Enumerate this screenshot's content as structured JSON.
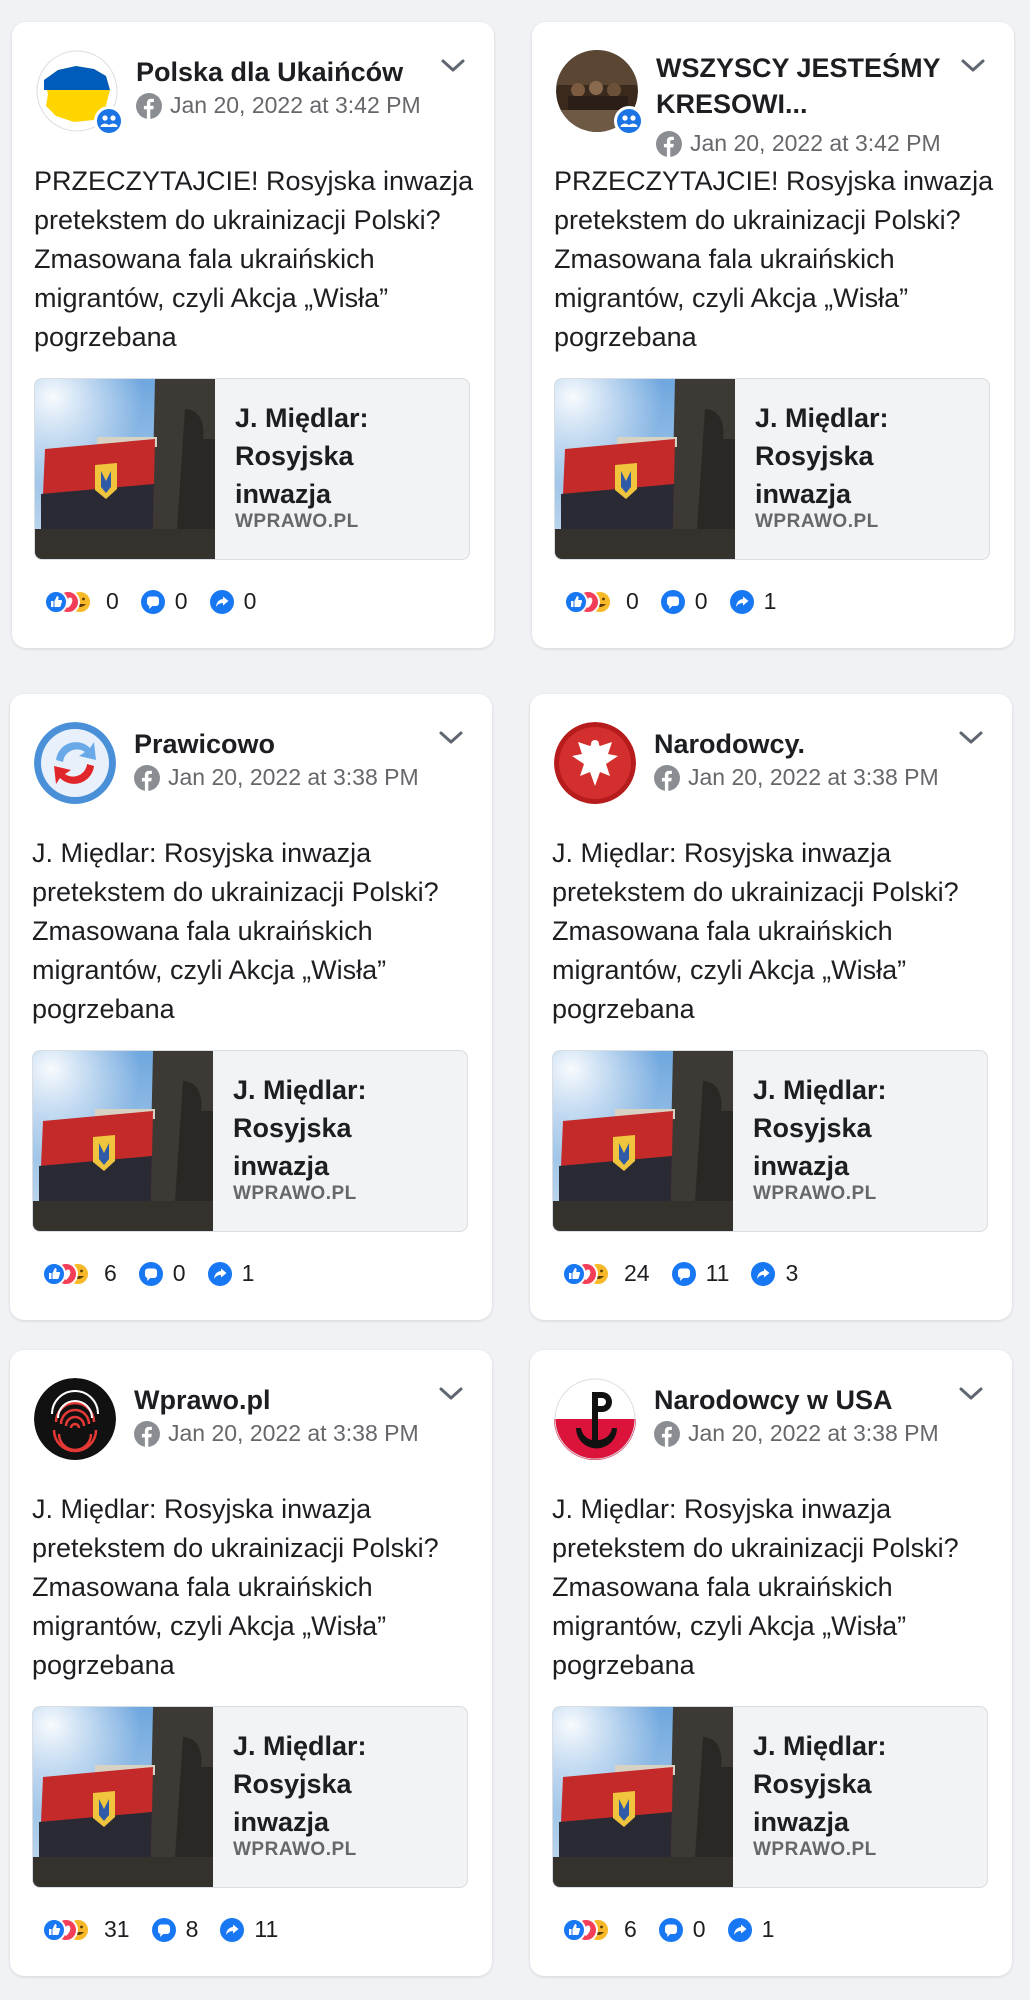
{
  "posts": [
    {
      "page_name": "Polska dla Ukaińców",
      "page_name_lines": 1,
      "timestamp": "Jan 20, 2022 at 3:42 PM",
      "is_group": true,
      "avatar": "poland-map-ukraine-flag",
      "text": "PRZECZYTAJCIE! Rosyjska inwazja pretekstem do ukrainizacji Polski? Zmasowana fala ukraińskich migrantów, czyli Akcja „Wisła” pogrzebana",
      "link_title": "J. Międlar:\nRosyjska\ninwazja",
      "link_domain": "WPRAWO.PL",
      "reactions": "0",
      "comments": "0",
      "shares": "0"
    },
    {
      "page_name": "WSZYSCY JESTEŚMY\nKRESOWI...",
      "page_name_lines": 2,
      "timestamp": "Jan 20, 2022 at 3:42 PM",
      "is_group": true,
      "avatar": "group-photo",
      "text": "PRZECZYTAJCIE! Rosyjska inwazja pretekstem do ukrainizacji Polski? Zmasowana fala ukraińskich migrantów, czyli Akcja „Wisła” pogrzebana",
      "link_title": "J. Międlar:\nRosyjska\ninwazja",
      "link_domain": "WPRAWO.PL",
      "reactions": "0",
      "comments": "0",
      "shares": "1"
    },
    {
      "page_name": "Prawicowo",
      "page_name_lines": 1,
      "timestamp": "Jan 20, 2022 at 3:38 PM",
      "is_group": false,
      "avatar": "refresh-logo",
      "text": "J. Międlar: Rosyjska inwazja pretekstem do ukrainizacji Polski? Zmasowana fala ukraińskich migrantów, czyli Akcja „Wisła” pogrzebana",
      "link_title": "J. Międlar:\nRosyjska\ninwazja",
      "link_domain": "WPRAWO.PL",
      "reactions": "6",
      "comments": "0",
      "shares": "1"
    },
    {
      "page_name": "Narodowcy.",
      "page_name_lines": 1,
      "timestamp": "Jan 20, 2022 at 3:38 PM",
      "is_group": false,
      "avatar": "white-eagle",
      "text": "J. Międlar: Rosyjska inwazja pretekstem do ukrainizacji Polski? Zmasowana fala ukraińskich migrantów, czyli Akcja „Wisła” pogrzebana",
      "link_title": "J. Międlar:\nRosyjska\ninwazja",
      "link_domain": "WPRAWO.PL",
      "reactions": "24",
      "comments": "11",
      "shares": "3"
    },
    {
      "page_name": "Wprawo.pl",
      "page_name_lines": 1,
      "timestamp": "Jan 20, 2022 at 3:38 PM",
      "is_group": false,
      "avatar": "fingerprint-logo",
      "text": "J. Międlar: Rosyjska inwazja pretekstem do ukrainizacji Polski? Zmasowana fala ukraińskich migrantów, czyli Akcja „Wisła” pogrzebana",
      "link_title": "J. Międlar:\nRosyjska\ninwazja",
      "link_domain": "WPRAWO.PL",
      "reactions": "31",
      "comments": "8",
      "shares": "11"
    },
    {
      "page_name": "Narodowcy w USA",
      "page_name_lines": 1,
      "timestamp": "Jan 20, 2022 at 3:38 PM",
      "is_group": false,
      "avatar": "kotwica-logo",
      "text": "J. Międlar: Rosyjska inwazja pretekstem do ukrainizacji Polski? Zmasowana fala ukraińskich migrantów, czyli Akcja „Wisła” pogrzebana",
      "link_title": "J. Międlar:\nRosyjska\ninwazja",
      "link_domain": "WPRAWO.PL",
      "reactions": "6",
      "comments": "0",
      "shares": "1"
    }
  ],
  "colors": {
    "background": "#f0f2f5",
    "card": "#ffffff",
    "meta_text": "#65676b",
    "facebook_blue": "#1b74e4",
    "like_blue": "#1877f2",
    "haha_yellow": "#f7b928",
    "love_red": "#f33e58"
  }
}
